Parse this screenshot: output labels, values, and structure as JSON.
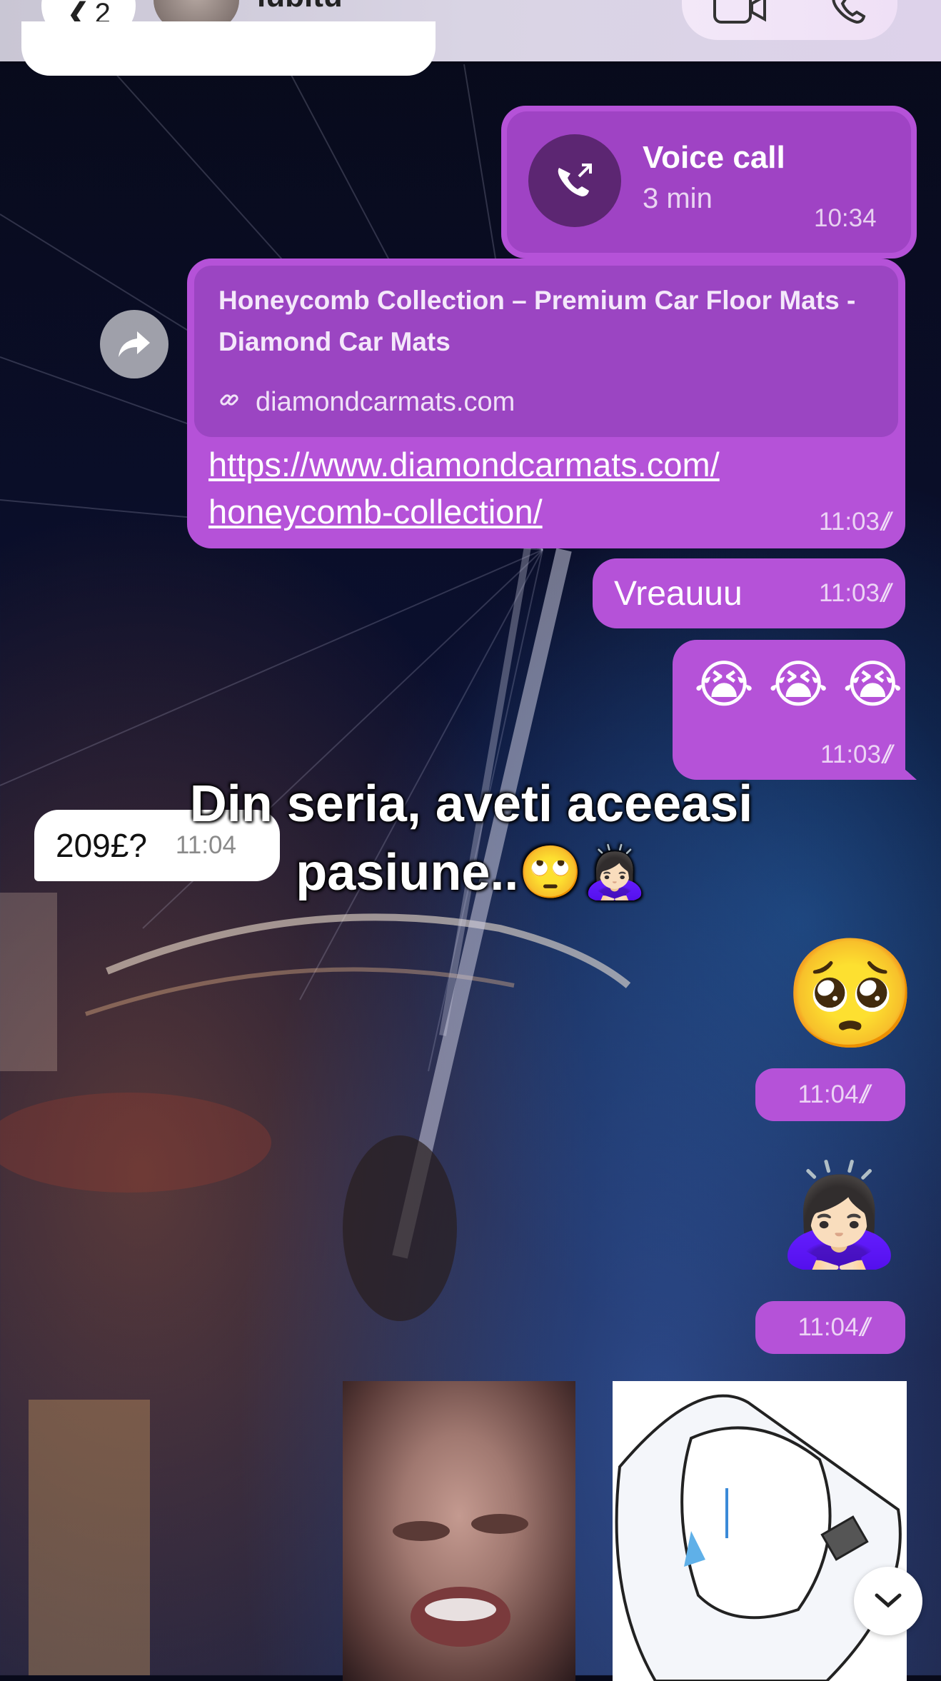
{
  "header": {
    "back_count": "2",
    "contact_name": "iubitu",
    "icons": [
      "chevron-left-icon",
      "video-camera-icon",
      "phone-icon"
    ]
  },
  "messages": {
    "voice_call": {
      "title": "Voice call",
      "duration": "3 min",
      "time": "10:34"
    },
    "link": {
      "preview_title": "Honeycomb Collection – Premium Car Floor Mats - Diamond Car Mats",
      "preview_domain": "diamondcarmats.com",
      "url_line1": "https://www.diamondcarmats.com/",
      "url_line2": "honeycomb-collection/",
      "time": "11:03"
    },
    "vreau": {
      "text": "Vreauuu",
      "time": "11:03"
    },
    "crying": {
      "emoji": "😭 😭 😭",
      "time": "11:03"
    },
    "incoming": {
      "text": "209£?",
      "time": "11:04"
    },
    "pleading": {
      "emoji": "🥺",
      "time": "11:04"
    },
    "bowing": {
      "emoji": "🙇🏻‍♀️",
      "time": "11:04"
    }
  },
  "overlay": {
    "line1": "Din seria, aveti aceeasi",
    "line2": "pasiune..🙄🙇🏻‍♀️"
  },
  "colors": {
    "outgoing_bubble": "#b552d8",
    "link_preview": "#9b45c2",
    "incoming_bubble": "#ffffff"
  }
}
